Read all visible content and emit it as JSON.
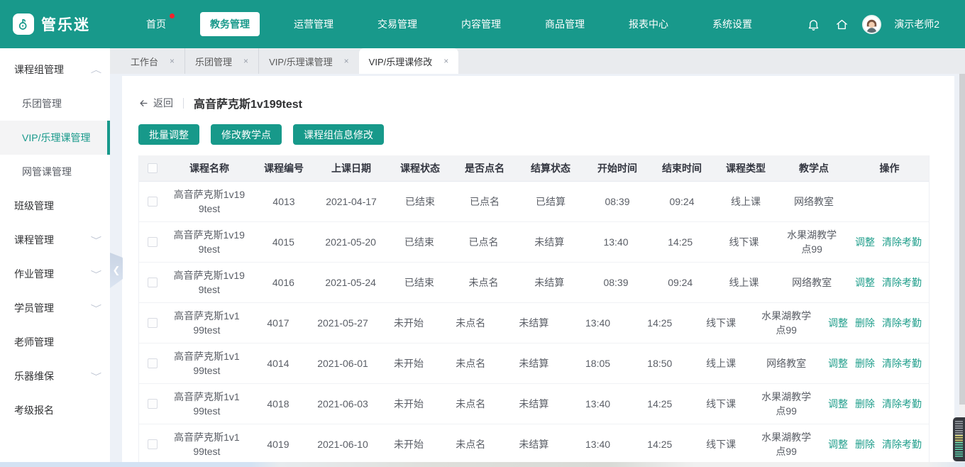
{
  "colors": {
    "accent": "#18998b",
    "link": "#1f9e8b",
    "badge": "#f5222d",
    "tabbar_bg": "#e9ebee",
    "page_bg": "#edf1f7"
  },
  "navbar": {
    "brand": "管乐迷",
    "items": [
      {
        "label": "首页",
        "active": false,
        "badge": true
      },
      {
        "label": "教务管理",
        "active": true,
        "badge": false
      },
      {
        "label": "运营管理",
        "active": false,
        "badge": false
      },
      {
        "label": "交易管理",
        "active": false,
        "badge": false
      },
      {
        "label": "内容管理",
        "active": false,
        "badge": false
      },
      {
        "label": "商品管理",
        "active": false,
        "badge": false
      },
      {
        "label": "报表中心",
        "active": false,
        "badge": false
      },
      {
        "label": "系统设置",
        "active": false,
        "badge": false
      }
    ],
    "user_name": "演示老师2"
  },
  "sidebar": {
    "items": [
      {
        "label": "课程组管理",
        "chevron": "up",
        "children": [
          {
            "label": "乐团管理",
            "active": false
          },
          {
            "label": "VIP/乐理课管理",
            "active": true
          },
          {
            "label": "网管课管理",
            "active": false
          }
        ]
      },
      {
        "label": "班级管理",
        "chevron": ""
      },
      {
        "label": "课程管理",
        "chevron": "down"
      },
      {
        "label": "作业管理",
        "chevron": "down"
      },
      {
        "label": "学员管理",
        "chevron": "down"
      },
      {
        "label": "老师管理",
        "chevron": ""
      },
      {
        "label": "乐器维保",
        "chevron": "down"
      },
      {
        "label": "考级报名",
        "chevron": ""
      }
    ]
  },
  "tabs": [
    {
      "label": "工作台",
      "active": false
    },
    {
      "label": "乐团管理",
      "active": false
    },
    {
      "label": "VIP/乐理课管理",
      "active": false
    },
    {
      "label": "VIP/乐理课修改",
      "active": true
    }
  ],
  "page": {
    "back": "返回",
    "title": "高音萨克斯1v199test",
    "buttons": [
      "批量调整",
      "修改教学点",
      "课程组信息修改"
    ]
  },
  "table": {
    "columns": [
      "课程名称",
      "课程编号",
      "上课日期",
      "课程状态",
      "是否点名",
      "结算状态",
      "开始时间",
      "结束时间",
      "课程类型",
      "教学点",
      "操作"
    ],
    "rows": [
      {
        "name": "高音萨克斯1v199test",
        "code": "4013",
        "date": "2021-04-17",
        "status": "已结束",
        "rollcall": "已点名",
        "settle": "已结算",
        "start": "08:39",
        "end": "09:24",
        "type": "线上课",
        "venue": "网络教室",
        "ops": []
      },
      {
        "name": "高音萨克斯1v199test",
        "code": "4015",
        "date": "2021-05-20",
        "status": "已结束",
        "rollcall": "已点名",
        "settle": "未结算",
        "start": "13:40",
        "end": "14:25",
        "type": "线下课",
        "venue": "水果湖教学点99",
        "ops": [
          "调整",
          "清除考勤"
        ]
      },
      {
        "name": "高音萨克斯1v199test",
        "code": "4016",
        "date": "2021-05-24",
        "status": "已结束",
        "rollcall": "未点名",
        "settle": "未结算",
        "start": "08:39",
        "end": "09:24",
        "type": "线上课",
        "venue": "网络教室",
        "ops": [
          "调整",
          "清除考勤"
        ]
      },
      {
        "name": "高音萨克斯1v199test",
        "code": "4017",
        "date": "2021-05-27",
        "status": "未开始",
        "rollcall": "未点名",
        "settle": "未结算",
        "start": "13:40",
        "end": "14:25",
        "type": "线下课",
        "venue": "水果湖教学点99",
        "ops": [
          "调整",
          "删除",
          "清除考勤"
        ]
      },
      {
        "name": "高音萨克斯1v199test",
        "code": "4014",
        "date": "2021-06-01",
        "status": "未开始",
        "rollcall": "未点名",
        "settle": "未结算",
        "start": "18:05",
        "end": "18:50",
        "type": "线上课",
        "venue": "网络教室",
        "ops": [
          "调整",
          "删除",
          "清除考勤"
        ]
      },
      {
        "name": "高音萨克斯1v199test",
        "code": "4018",
        "date": "2021-06-03",
        "status": "未开始",
        "rollcall": "未点名",
        "settle": "未结算",
        "start": "13:40",
        "end": "14:25",
        "type": "线下课",
        "venue": "水果湖教学点99",
        "ops": [
          "调整",
          "删除",
          "清除考勤"
        ]
      },
      {
        "name": "高音萨克斯1v199test",
        "code": "4019",
        "date": "2021-06-10",
        "status": "未开始",
        "rollcall": "未点名",
        "settle": "未结算",
        "start": "13:40",
        "end": "14:25",
        "type": "线下课",
        "venue": "水果湖教学点99",
        "ops": [
          "调整",
          "删除",
          "清除考勤"
        ]
      }
    ]
  }
}
